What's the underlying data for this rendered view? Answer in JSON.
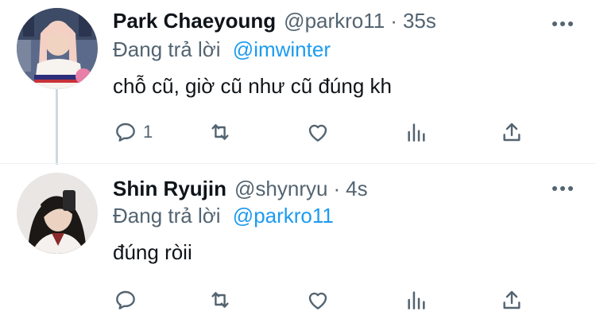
{
  "tweets": [
    {
      "name": "Park Chaeyoung",
      "handle": "@parkro11",
      "separator": "·",
      "time": "35s",
      "reply_prefix": "Đang trả lời",
      "reply_to": "@imwinter",
      "text": "chỗ cũ, giờ cũ như cũ đúng kh",
      "reply_count": "1",
      "avatar": "avatar-photo"
    },
    {
      "name": "Shin Ryujin",
      "handle": "@shynryu",
      "separator": "·",
      "time": "4s",
      "reply_prefix": "Đang trả lời",
      "reply_to": "@parkro11",
      "text": "đúng ròii",
      "reply_count": "",
      "avatar": "avatar-photo"
    }
  ],
  "icons": [
    "reply-icon",
    "retweet-icon",
    "like-icon",
    "views-icon",
    "share-icon",
    "more-icon"
  ],
  "colors": {
    "text": "#0f1419",
    "secondary": "#536471",
    "accent": "#1d9bf0",
    "thread_line": "#cfd9de"
  }
}
